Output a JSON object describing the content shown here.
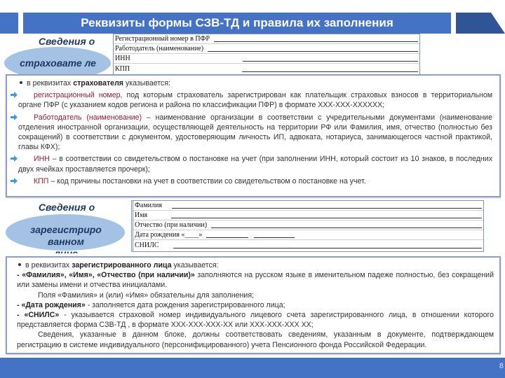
{
  "title": "Реквизиты формы СЗВ-ТД и правила их заполнения",
  "colors": {
    "accent": "#4472c4",
    "accent_dark": "#2f5597",
    "ellipse": "#a4c2e3",
    "highlight_red": "#9b1c31"
  },
  "insurer_section": {
    "heading": "Сведения о",
    "ellipse_text": "страховате ле",
    "form_fields": [
      {
        "label": "Регистрационный номер в ПФР"
      },
      {
        "label": "Работодатель (наименование)"
      },
      {
        "label": "ИНН"
      },
      {
        "label": "КПП"
      }
    ],
    "intro": {
      "pre": "в реквизитах ",
      "bold": "страхователя",
      "post": " указывается:"
    },
    "items": [
      {
        "icon": "arrow-right-icon",
        "term": "регистрационный номер",
        "text": ", под которым страхователь зарегистрирован как плательщик страховых взносов в территориальном органе ПФР (с указанием кодов региона и района по классификации ПФР) в формате XXX-XXX-XXXXXX;"
      },
      {
        "icon": "arrow-right-icon",
        "term": "Работодатель (наименование)",
        "text": " – наименование организации в соответствии с учредительными документами (наименование отделения иностранной организации, осуществляющей деятельность  на территории РФ или Фамилия, имя, отчество (полностью без сокращений) в соответствии с документом, удостоверяющим личность ИП, адвоката, нотариуса, занимающегося частной практикой, главы КФХ);"
      },
      {
        "icon": "arrow-right-icon",
        "term": "ИНН",
        "text": " – в соответствии со свидетельством о постановке на учет  (при заполнении ИНН, который состоит из 10 знаков, в последних двух ячейках проставляется прочерк);"
      },
      {
        "icon": "arrow-right-icon",
        "term": "КПП",
        "text": " – код причины постановки на учет в соответствии со свидетельством о постановке на учет."
      }
    ]
  },
  "insured_section": {
    "heading": "Сведения о",
    "ellipse_text_1": "зарегистриро",
    "ellipse_text_2": "ванном",
    "ellipse_text_3": "лице",
    "form_fields": [
      {
        "label": "Фамилия"
      },
      {
        "label": "Имя"
      },
      {
        "label": "Отчество (при наличии)"
      },
      {
        "label": "Дата рождения «____» "
      },
      {
        "label": "СНИЛС"
      }
    ],
    "intro": {
      "pre": "в реквизитах ",
      "bold": "зарегистрированного лица",
      "post": " указывается:"
    },
    "line1": {
      "dash": " - ",
      "term": "«Фамилия», «Имя», «Отчество (при наличии)»",
      "text": " заполняются на русском языке в именительном падеже полностью, без сокращений или замены имени и отчества инициалами."
    },
    "line2": "Поля «Фамилия» и (или) «Имя» обязательны для заполнения;",
    "line3": {
      "dash": " - ",
      "term": "«Дата рождения»",
      "text": " - заполняется дата рождения зарегистрированного лица;"
    },
    "line4": {
      "dash": " - ",
      "term": "«СНИЛС»",
      "text": " - указывается страховой номер индивидуального лицевого счета зарегистрированного лица, в отношении которого представляется форма СЗВ-ТД , в формате XXX-XXX-XXX-XX или XXX-XXX-XXX XX;"
    },
    "line5": "Сведения, указанные в данном блоке, должны соответствовать сведениям, указанным в документе, подтверждающем регистрацию в системе индивидуального (персонифицированного) учета Пенсионного фонда  Российской Федерации."
  },
  "footer": {
    "page_number": "8"
  }
}
